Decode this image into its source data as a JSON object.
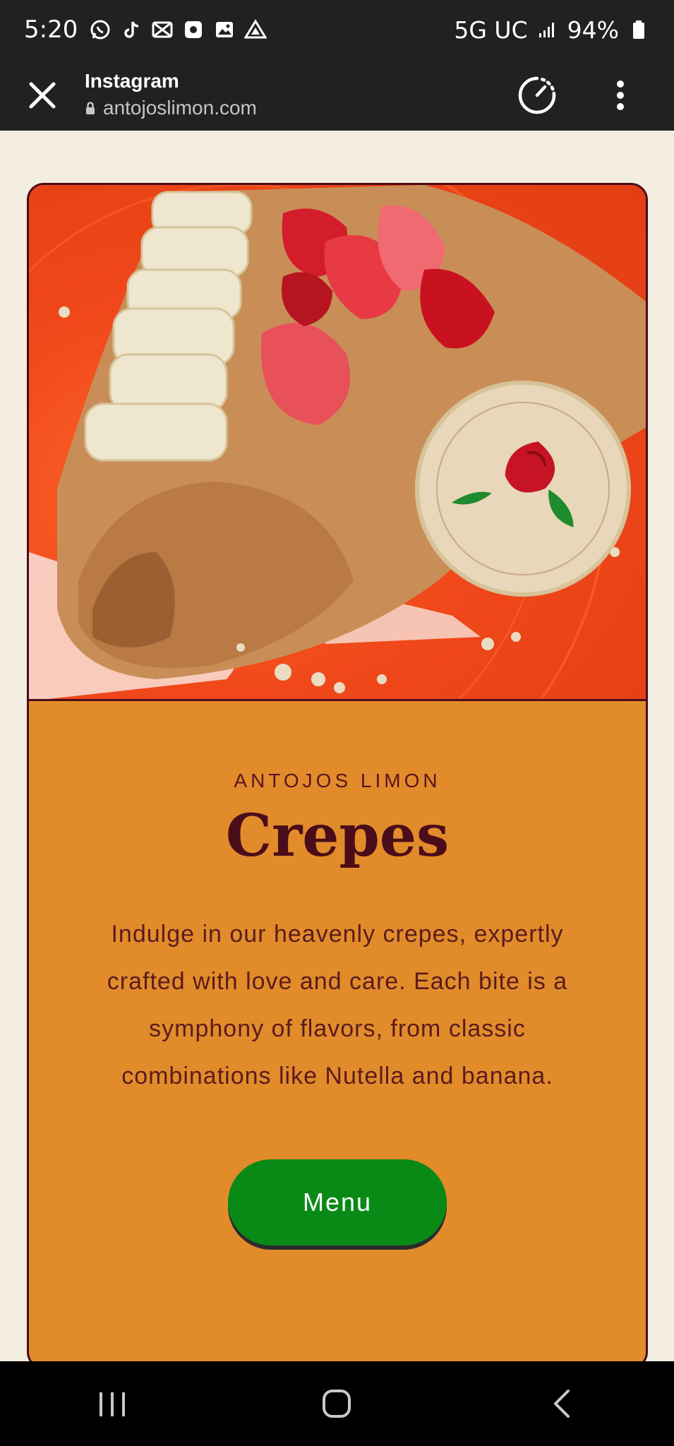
{
  "status_bar": {
    "time": "5:20",
    "network": "5G UC",
    "battery": "94%",
    "notification_icons": [
      "whatsapp-icon",
      "tiktok-icon",
      "capcut-icon",
      "camera-app-icon",
      "gallery-icon",
      "drive-icon"
    ]
  },
  "browser": {
    "title": "Instagram",
    "url": "antojoslimon.com",
    "close_icon": "close-icon",
    "actions": [
      "speedometer-icon",
      "more-vertical-icon"
    ]
  },
  "card": {
    "kicker": "ANTOJOS LIMON",
    "heading": "Crepes",
    "description": "Indulge in our heavenly crepes, expertly crafted with love and care. Each bite is a symphony of flavors, from classic combinations like Nutella and banana.",
    "button_label": "Menu",
    "hero_image": "crepe-with-banana-strawberries-and-mazapan-photo"
  },
  "colors": {
    "page_bg": "#f3eee0",
    "card_bg": "#e28b2b",
    "card_border": "#4a0d1a",
    "button_bg": "#098a17",
    "browser_bar": "#212121"
  },
  "nav_bar": [
    "recents-icon",
    "home-icon",
    "back-icon"
  ]
}
